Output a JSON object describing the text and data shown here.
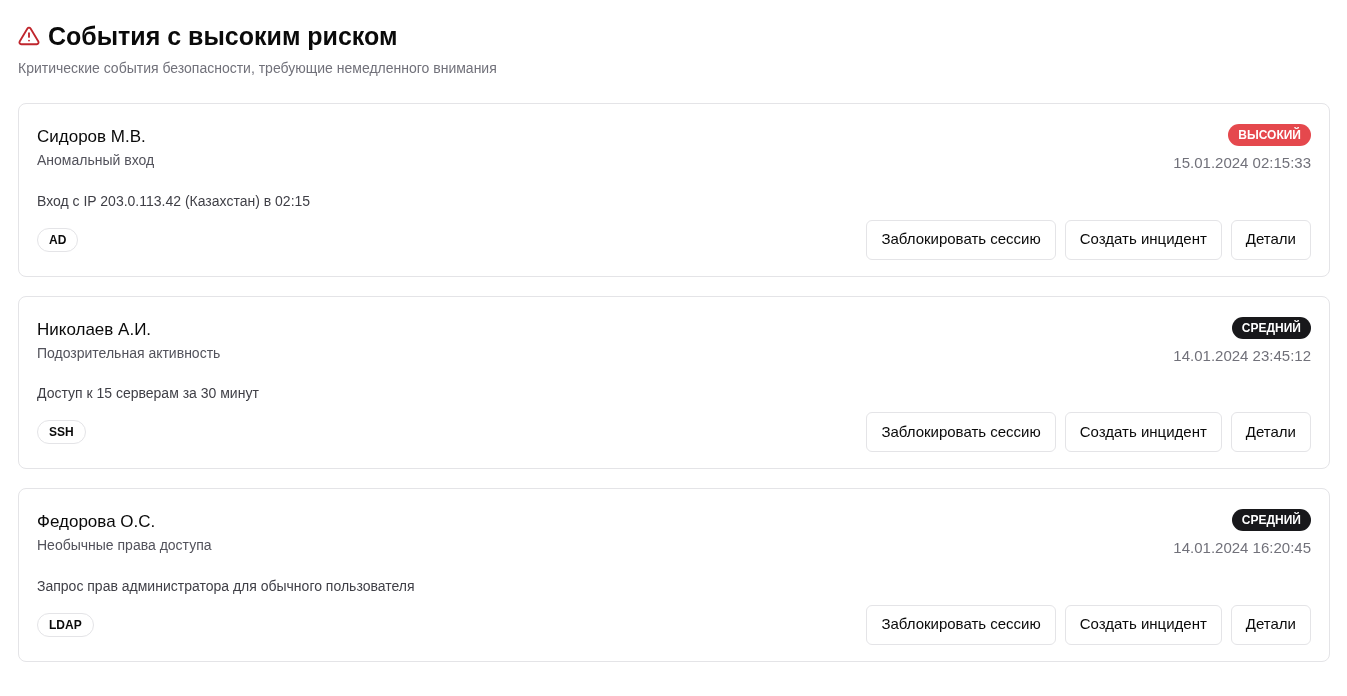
{
  "header": {
    "title": "События с высоким риском",
    "subtitle": "Критические события безопасности, требующие немедленного внимания"
  },
  "events": [
    {
      "user": "Сидоров М.В.",
      "type": "Аномальный вход",
      "description": "Вход с IP 203.0.113.42 (Казахстан) в 02:15",
      "source": "AD",
      "risk": {
        "label": "ВЫСОКИЙ",
        "color": "#e5484d"
      },
      "timestamp": "15.01.2024 02:15:33",
      "actions": [
        "Заблокировать сессию",
        "Создать инцидент",
        "Детали"
      ]
    },
    {
      "user": "Николаев А.И.",
      "type": "Подозрительная активность",
      "description": "Доступ к 15 серверам за 30 минут",
      "source": "SSH",
      "risk": {
        "label": "СРЕДНИЙ",
        "color": "#18181b"
      },
      "timestamp": "14.01.2024 23:45:12",
      "actions": [
        "Заблокировать сессию",
        "Создать инцидент",
        "Детали"
      ]
    },
    {
      "user": "Федорова О.С.",
      "type": "Необычные права доступа",
      "description": "Запрос прав администратора для обычного пользователя",
      "source": "LDAP",
      "risk": {
        "label": "СРЕДНИЙ",
        "color": "#18181b"
      },
      "timestamp": "14.01.2024 16:20:45",
      "actions": [
        "Заблокировать сессию",
        "Создать инцидент",
        "Детали"
      ]
    }
  ]
}
